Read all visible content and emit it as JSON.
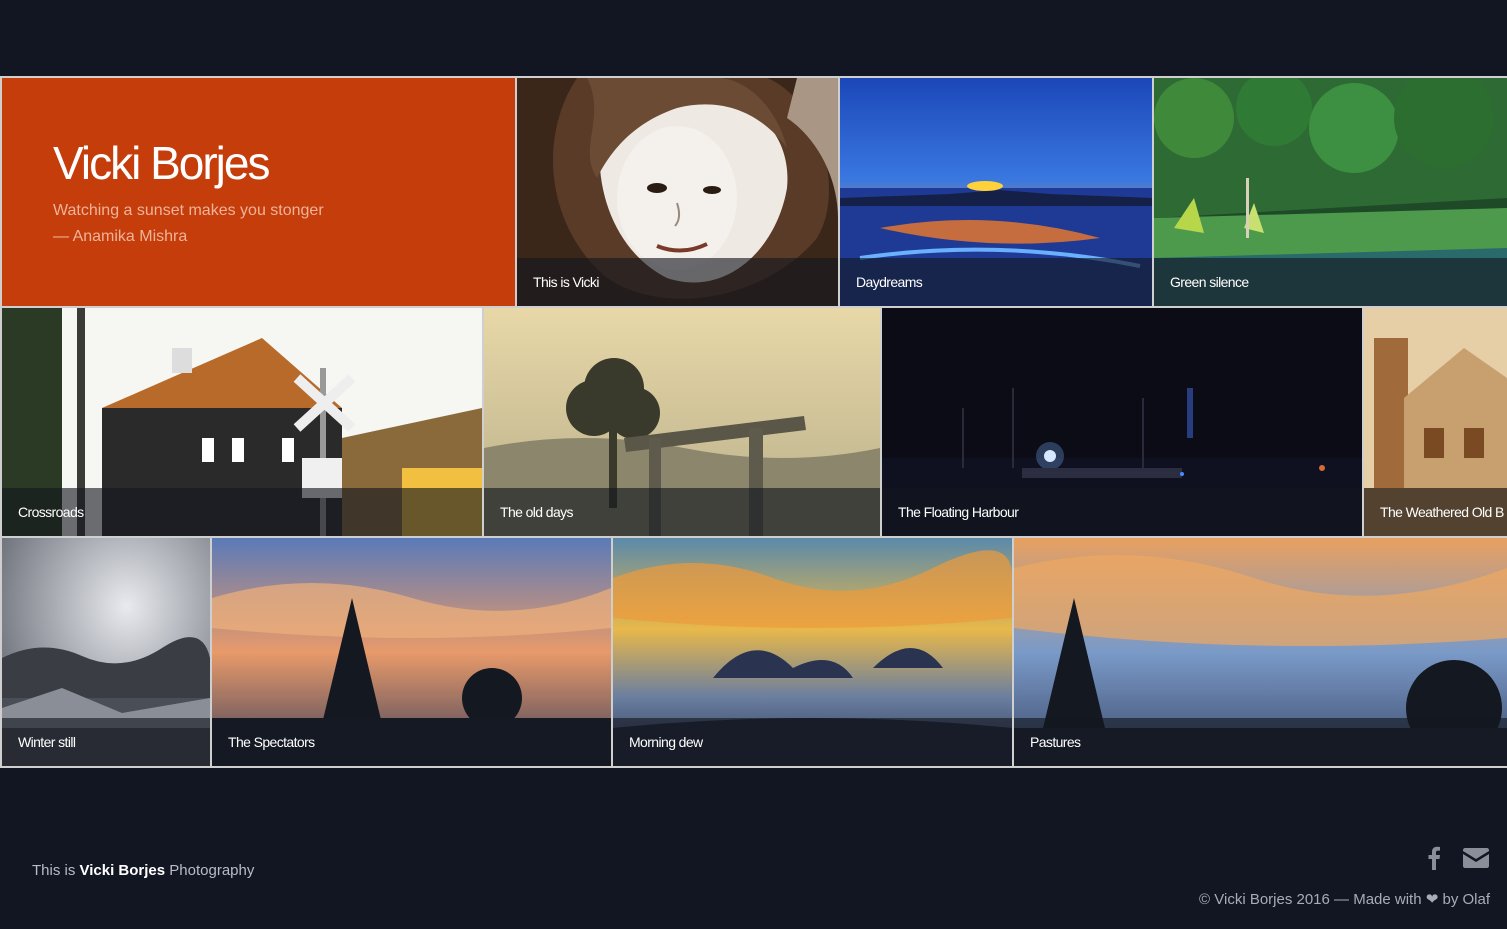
{
  "site": {
    "title": "Vicki Borjes",
    "quote_line1": "Watching a sunset makes you stonger",
    "quote_line2": "— Anamika Mishra"
  },
  "gallery": [
    {
      "caption": "This is Vicki"
    },
    {
      "caption": "Daydreams"
    },
    {
      "caption": "Green silence"
    },
    {
      "caption": "Crossroads"
    },
    {
      "caption": "The old days"
    },
    {
      "caption": "The Floating Harbour"
    },
    {
      "caption": "The Weathered Old B"
    },
    {
      "caption": "Winter still"
    },
    {
      "caption": "The Spectators"
    },
    {
      "caption": "Morning dew"
    },
    {
      "caption": "Pastures"
    }
  ],
  "footer": {
    "left_prefix": "This is",
    "left_name": "Vicki Borjes",
    "left_suffix": "Photography",
    "copyright": "© Vicki Borjes 2016 — Made with ❤ by Olaf",
    "social_icons": [
      "facebook-icon",
      "mail-icon"
    ]
  },
  "colors": {
    "background": "#121622",
    "hero_accent": "#c43d0a"
  }
}
